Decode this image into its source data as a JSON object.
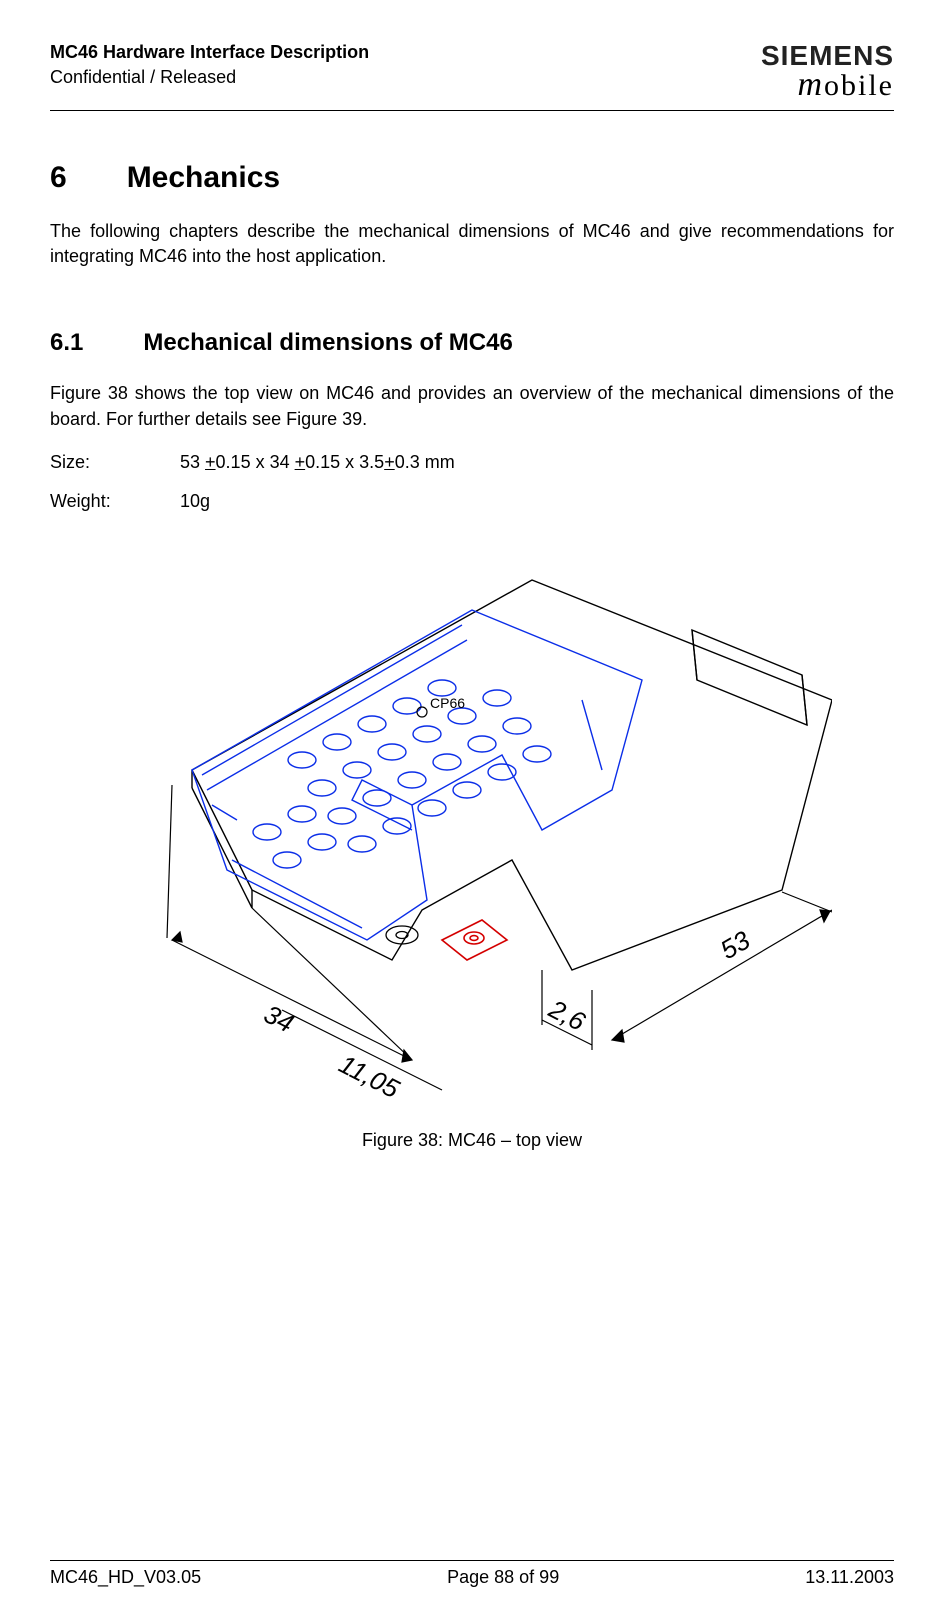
{
  "header": {
    "title": "MC46 Hardware Interface Description",
    "subtitle": "Confidential / Released",
    "brand_top": "SIEMENS",
    "brand_bottom": "mobile"
  },
  "section": {
    "num": "6",
    "title": "Mechanics",
    "intro": "The following chapters describe the mechanical dimensions of MC46 and give recommendations for integrating MC46 into the host application."
  },
  "subsection": {
    "num": "6.1",
    "title": "Mechanical dimensions of MC46",
    "intro": "Figure 38 shows the top view on MC46 and provides an overview of the mechanical dimensions of the board. For further details see Figure 39."
  },
  "specs": {
    "size_label": "Size:",
    "size_value": "53 +0.15 x 34 +0.15 x 3.5+0.3 mm",
    "weight_label": "Weight:",
    "weight_value": "10g"
  },
  "figure": {
    "caption": "Figure 38: MC46 – top view",
    "label_cp66": "CP66",
    "dim_34": "34",
    "dim_11_05": "11,05",
    "dim_2_6": "2,6",
    "dim_53": "53"
  },
  "footer": {
    "left": "MC46_HD_V03.05",
    "center": "Page 88 of 99",
    "right": "13.11.2003"
  }
}
